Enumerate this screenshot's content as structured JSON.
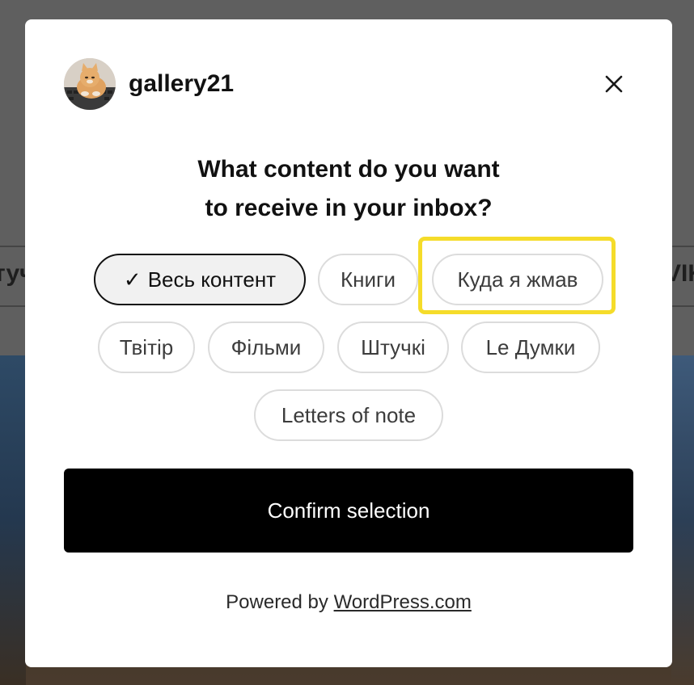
{
  "background": {
    "nav_left_fragment": "туч",
    "nav_right_fragment": "VIK"
  },
  "modal": {
    "site_name": "gallery21",
    "avatar_icon": "cat-avatar",
    "close_icon": "close-icon",
    "heading_line1": "What content do you want",
    "heading_line2": "to receive in your inbox?",
    "categories": [
      {
        "label": "Весь контент",
        "selected": true,
        "check": "✓"
      },
      {
        "label": "Книги",
        "selected": false
      },
      {
        "label": "Куда я жмав",
        "selected": false,
        "highlighted": true
      },
      {
        "label": "Твітір",
        "selected": false
      },
      {
        "label": "Фільми",
        "selected": false
      },
      {
        "label": "Штучкі",
        "selected": false
      },
      {
        "label": "Le Думки",
        "selected": false
      },
      {
        "label": "Letters of note",
        "selected": false
      }
    ],
    "confirm_label": "Confirm selection",
    "powered_prefix": "Powered by ",
    "powered_link": "WordPress.com"
  },
  "colors": {
    "highlight": "#f5dc2a",
    "confirm_bg": "#000000",
    "overlay": "#5e5e5e"
  }
}
